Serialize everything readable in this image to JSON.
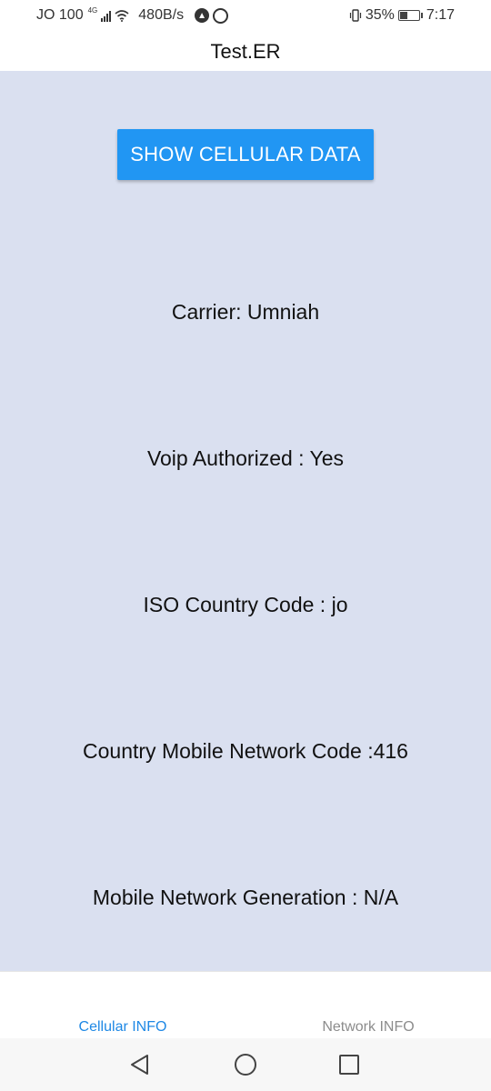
{
  "status_bar": {
    "carrier": "JO 100",
    "network_type": "4G",
    "speed": "480B/s",
    "battery": "35%",
    "time": "7:17"
  },
  "header": {
    "title": "Test.ER"
  },
  "main": {
    "button_label": "SHOW CELLULAR DATA",
    "lines": [
      "Carrier: Umniah",
      "Voip Authorized : Yes",
      "ISO Country Code : jo",
      "Country Mobile Network Code :416",
      "Mobile Network Generation : N/A"
    ]
  },
  "tabs": [
    {
      "label": "Cellular INFO",
      "active": true
    },
    {
      "label": "Network INFO",
      "active": false
    }
  ],
  "colors": {
    "accent": "#2196f3",
    "background": "#dae0f0",
    "active_tab": "#1e88e5",
    "inactive_tab": "#8c8c8c"
  },
  "icons": {
    "nav_back": "back-triangle-icon",
    "nav_home": "home-circle-icon",
    "nav_recent": "recent-square-icon"
  }
}
